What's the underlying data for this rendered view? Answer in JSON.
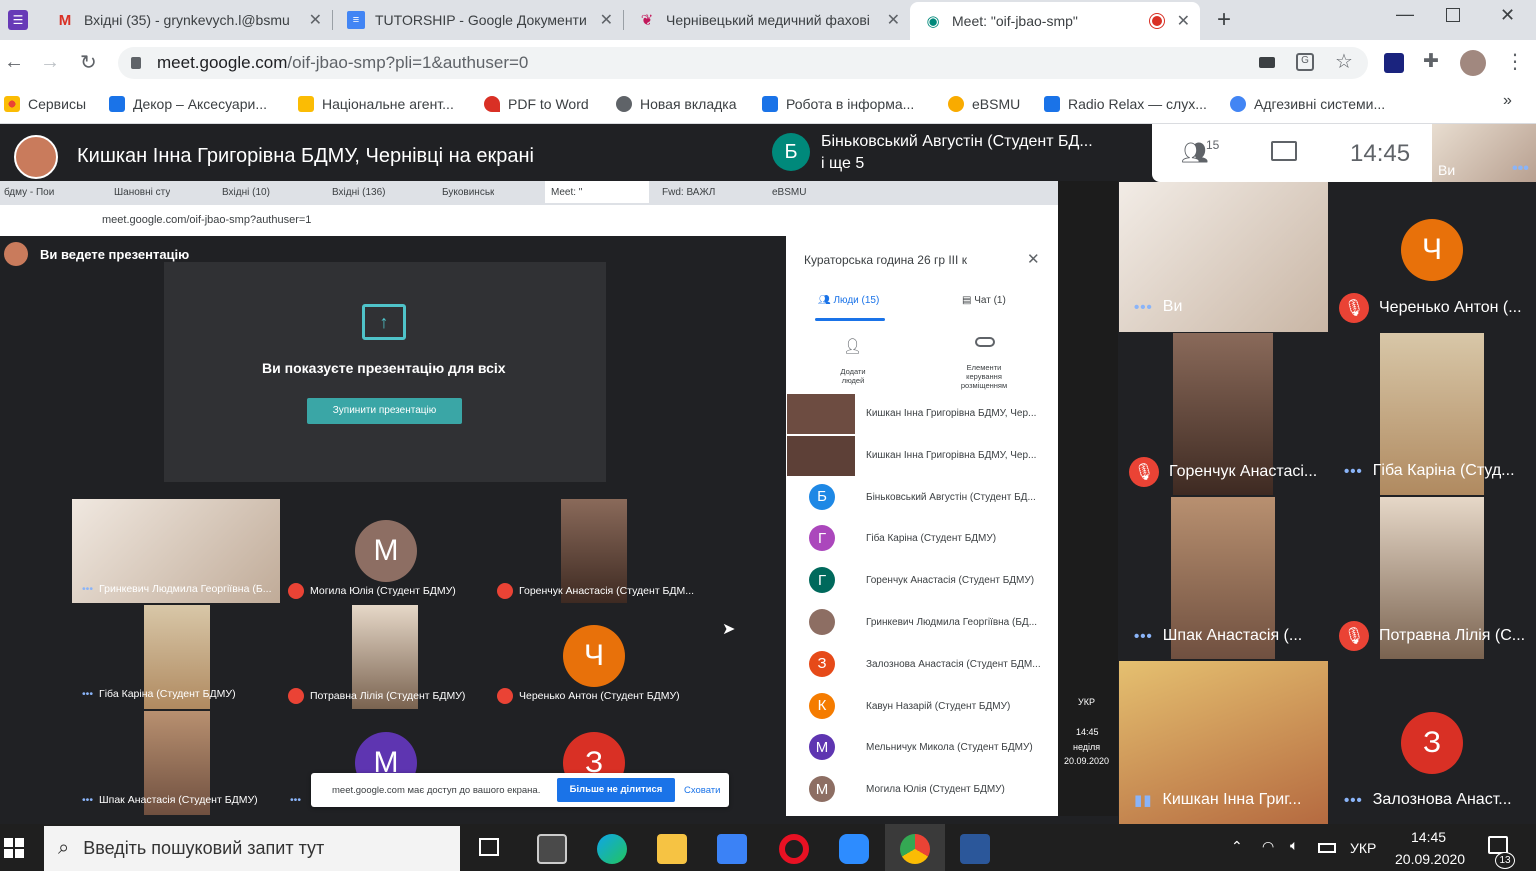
{
  "tabs": [
    {
      "label": "Вхідні (35) - grynkevych.l@bsmu",
      "icon": "gmail-icon"
    },
    {
      "label": "TUTORSHIP - Google Документи",
      "icon": "docs-icon"
    },
    {
      "label": "Чернівецький медичний фахові",
      "icon": "bird-icon"
    },
    {
      "label": "Meet: \"oif-jbao-smp\"",
      "icon": "meet-icon"
    }
  ],
  "address": {
    "host": "meet.google.com",
    "path": "/oif-jbao-smp?pli=1&authuser=0"
  },
  "bookmarks": [
    {
      "label": "Сервисы",
      "color": "#ea4335"
    },
    {
      "label": "Декор – Аксесуари...",
      "color": "#1a73e8"
    },
    {
      "label": "Національне агент...",
      "color": "#fbbc04"
    },
    {
      "label": "PDF to Word",
      "color": "#d93025"
    },
    {
      "label": "Новая вкладка",
      "color": "#5f6368"
    },
    {
      "label": "Робота в інформа...",
      "color": "#1a73e8"
    },
    {
      "label": "eBSMU",
      "color": "#f9ab00"
    },
    {
      "label": "Radio Relax — слух...",
      "color": "#1a73e8"
    },
    {
      "label": "Адгезивні системи...",
      "color": "#4285f4"
    }
  ],
  "bookmarks_more": "»",
  "presenter": {
    "title": "Кишкан Інна Григорівна БДМУ, Чернівці на екрані"
  },
  "notice": {
    "avatar_letter": "Б",
    "line1": "Біньковський Августін (Студент БД...",
    "line2": "і ще 5"
  },
  "top_controls": {
    "people_count": "15",
    "time": "14:45",
    "self_label": "Ви"
  },
  "right_tiles": [
    {
      "name": "Ви",
      "status": "dots"
    },
    {
      "name": "Черенько Антон (...",
      "status": "muted",
      "letter": "Ч",
      "color": "#e8710a"
    },
    {
      "name": "Горенчук Анастасі...",
      "status": "muted"
    },
    {
      "name": "Гіба Каріна (Студ...",
      "status": "dots"
    },
    {
      "name": "Шпак Анастасія (...",
      "status": "dots"
    },
    {
      "name": "Потравна Лілія (С...",
      "status": "muted"
    },
    {
      "name": "Кишкан Інна Григ...",
      "status": "speaking"
    },
    {
      "name": "Залознова Анаст...",
      "status": "dots",
      "letter": "З",
      "color": "#d93025"
    }
  ],
  "inner": {
    "tabs": [
      "бдму - Пои",
      "Шановні сту",
      "Вхідні (10)",
      "Вхідні (136)",
      "Буковинськ",
      "Meet: \"",
      "Fwd: ВАЖЛ",
      "eBSMU"
    ],
    "url": "meet.google.com/oif-jbao-smp?authuser=1",
    "presenting_label": "Ви ведете презентацію",
    "presenting_text": "Ви показуєте презентацію для всіх",
    "stop_button": "Зупинити презентацію",
    "tiles": [
      {
        "name": "Гринкевич Людмила Георгіївна (Б..."
      },
      {
        "name": "Могила Юлія (Студент БДМУ)",
        "letter": "М",
        "color": "#8d6e63"
      },
      {
        "name": "Горенчук Анастасія (Студент БДМ..."
      },
      {
        "name": "Гіба Каріна (Студент БДМУ)"
      },
      {
        "name": "Потравна Лілія (Студент БДМУ)"
      },
      {
        "name": "Черенько Антон (Студент БДМУ)",
        "letter": "Ч",
        "color": "#e8710a"
      },
      {
        "name": "Шпак Анастасія (Студент БДМУ)"
      },
      {
        "name": "",
        "letter": "М",
        "color": "#5e35b1"
      },
      {
        "name": "",
        "letter": "З",
        "color": "#d93025"
      }
    ],
    "share_bar": {
      "text": "meet.google.com має доступ до вашого екрана.",
      "stop": "Більше не ділитися",
      "hide": "Сховати"
    },
    "panel": {
      "title": "Кураторська година 26 гр III к",
      "tab_people": "Люди (15)",
      "tab_chat": "Чат (1)",
      "add_people": "Додати людей",
      "host_controls": "Елементи керування розміщенням",
      "people": [
        {
          "name": "Кишкан Інна Григорівна БДМУ, Чер...",
          "letter": "",
          "color": "#6d4c41"
        },
        {
          "name": "Кишкан Інна Григорівна БДМУ, Чер...",
          "letter": "",
          "color": "#5d4037"
        },
        {
          "name": "Біньковський Августін (Студент БД...",
          "letter": "Б",
          "color": "#1e88e5"
        },
        {
          "name": "Гіба Каріна (Студент БДМУ)",
          "letter": "Г",
          "color": "#ab47bc"
        },
        {
          "name": "Горенчук Анастасія (Студент БДМУ)",
          "letter": "Г",
          "color": "#00695c"
        },
        {
          "name": "Гринкевич Людмила Георгіївна (БД...",
          "letter": "",
          "color": "#8d6e63"
        },
        {
          "name": "Залознова Анастасія (Студент БДМ...",
          "letter": "З",
          "color": "#e64a19"
        },
        {
          "name": "Кавун Назарій (Студент БДМУ)",
          "letter": "К",
          "color": "#f57c00"
        },
        {
          "name": "Мельничук Микола (Студент БДМУ)",
          "letter": "М",
          "color": "#5e35b1"
        },
        {
          "name": "Могила Юлія (Студент БДМУ)",
          "letter": "М",
          "color": "#8d6e63"
        }
      ]
    },
    "tray": {
      "lang": "УКР",
      "time": "14:45",
      "day": "неділя",
      "date": "20.09.2020"
    }
  },
  "taskbar": {
    "search_placeholder": "Введіть пошуковий запит тут",
    "lang": "УКР",
    "time": "14:45",
    "date": "20.09.2020",
    "notifications": "13"
  }
}
